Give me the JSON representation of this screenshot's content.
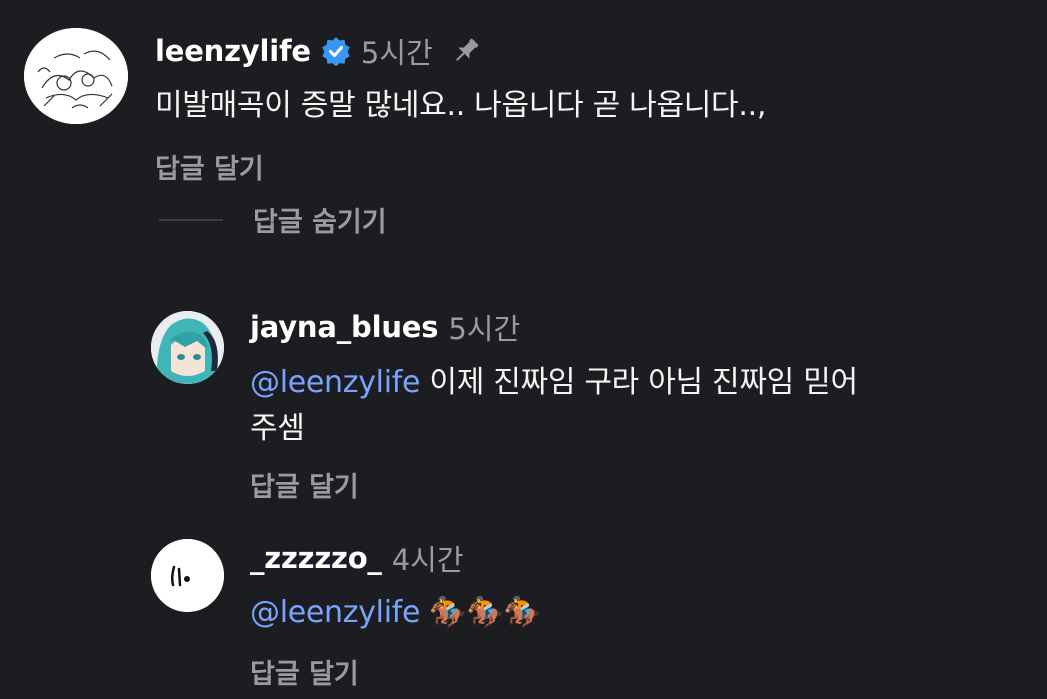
{
  "comment": {
    "username": "leenzylife",
    "time": "5시간",
    "text": "미발매곡이 증말 많네요.. 나옵니다 곧 나옵니다..,",
    "reply_label": "답글 달기",
    "hide_replies_label": "답글 숨기기",
    "icons": [
      "verified-badge-icon",
      "pin-icon"
    ]
  },
  "replies": [
    {
      "username": "jayna_blues",
      "time": "5시간",
      "mention": "@leenzylife",
      "text": " 이제 진짜임 구라 아님 진짜임 믿어",
      "text_cont": "주셈",
      "reply_label": "답글 달기"
    },
    {
      "username": "_zzzzzo_",
      "time": "4시간",
      "mention": "@leenzylife",
      "text": " 🏇🏇🏇",
      "reply_label": "답글 달기"
    }
  ],
  "colors": {
    "background": "#1c1d20",
    "mention": "#7aa2ff",
    "muted": "#9a9ba0",
    "verified": "#3897f0"
  }
}
